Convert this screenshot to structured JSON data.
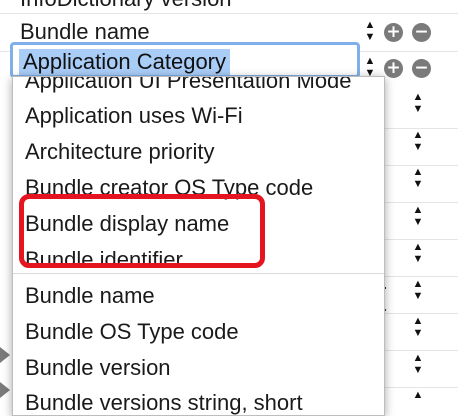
{
  "table": {
    "partial_top_row": "InfoDictionary version",
    "row_bundle_name": "Bundle name",
    "editing_key": "Application Category",
    "stepper_up": "▲",
    "stepper_down": "▼",
    "add_symbol": "+",
    "remove_symbol": "−"
  },
  "dropdown": {
    "items": [
      "Application UI Presentation Mode",
      "Application uses Wi-Fi",
      "Architecture priority",
      "Bundle creator OS Type code",
      "Bundle display name",
      "Bundle identifier",
      "Bundle name",
      "Bundle OS Type code",
      "Bundle version",
      "Bundle versions string, short"
    ]
  },
  "annotation": {
    "color": "#e4151f"
  },
  "colors": {
    "selection": "#a9cdf7",
    "focus_ring": "#7fb0ea"
  }
}
